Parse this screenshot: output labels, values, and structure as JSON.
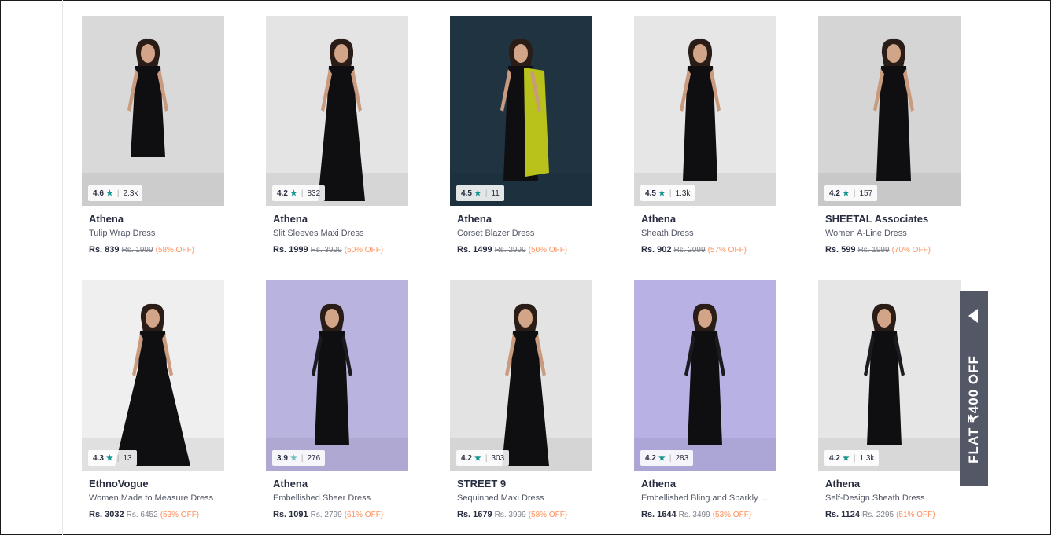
{
  "products": [
    {
      "brand": "Athena",
      "name": "Tulip Wrap Dress",
      "price": "Rs. 839",
      "mrp": "Rs. 1999",
      "discount": "(58% OFF)",
      "rating": "4.6",
      "reviews": "2.3k",
      "bg": "#d9d9d9"
    },
    {
      "brand": "Athena",
      "name": "Slit Sleeves Maxi Dress",
      "price": "Rs. 1999",
      "mrp": "Rs. 3999",
      "discount": "(50% OFF)",
      "rating": "4.2",
      "reviews": "832",
      "bg": "#e4e4e4"
    },
    {
      "brand": "Athena",
      "name": "Corset Blazer Dress",
      "price": "Rs. 1499",
      "mrp": "Rs. 2999",
      "discount": "(50% OFF)",
      "rating": "4.5",
      "reviews": "11",
      "bg": "#1f3341"
    },
    {
      "brand": "Athena",
      "name": "Sheath Dress",
      "price": "Rs. 902",
      "mrp": "Rs. 2099",
      "discount": "(57% OFF)",
      "rating": "4.5",
      "reviews": "1.3k",
      "bg": "#e6e6e6"
    },
    {
      "brand": "SHEETAL Associates",
      "name": "Women A-Line Dress",
      "price": "Rs. 599",
      "mrp": "Rs. 1999",
      "discount": "(70% OFF)",
      "rating": "4.2",
      "reviews": "157",
      "bg": "#d5d5d5"
    },
    {
      "brand": "EthnoVogue",
      "name": "Women Made to Measure Dress",
      "price": "Rs. 3032",
      "mrp": "Rs. 6452",
      "discount": "(53% OFF)",
      "rating": "4.3",
      "reviews": "13",
      "bg": "#efefef"
    },
    {
      "brand": "Athena",
      "name": "Embellished Sheer Dress",
      "price": "Rs. 1091",
      "mrp": "Rs. 2799",
      "discount": "(61% OFF)",
      "rating": "3.9",
      "reviews": "276",
      "bg": "#b9b3e0"
    },
    {
      "brand": "STREET 9",
      "name": "Sequinned Maxi Dress",
      "price": "Rs. 1679",
      "mrp": "Rs. 3999",
      "discount": "(58% OFF)",
      "rating": "4.2",
      "reviews": "303",
      "bg": "#e3e3e3"
    },
    {
      "brand": "Athena",
      "name": "Embellished Bling and Sparkly ...",
      "price": "Rs. 1644",
      "mrp": "Rs. 3499",
      "discount": "(53% OFF)",
      "rating": "4.2",
      "reviews": "283",
      "bg": "#b7b1e4"
    },
    {
      "brand": "Athena",
      "name": "Self-Design Sheath Dress",
      "price": "Rs. 1124",
      "mrp": "Rs. 2295",
      "discount": "(51% OFF)",
      "rating": "4.2",
      "reviews": "1.3k",
      "bg": "#e6e6e6"
    }
  ],
  "promo": {
    "label": "FLAT ₹400 OFF"
  },
  "icons": {
    "star": "star-icon",
    "promo_arrow": "chevron-left-icon"
  },
  "colors": {
    "rating_star": "#14958f",
    "discount": "#ff905a",
    "promo_bg": "#535766"
  }
}
